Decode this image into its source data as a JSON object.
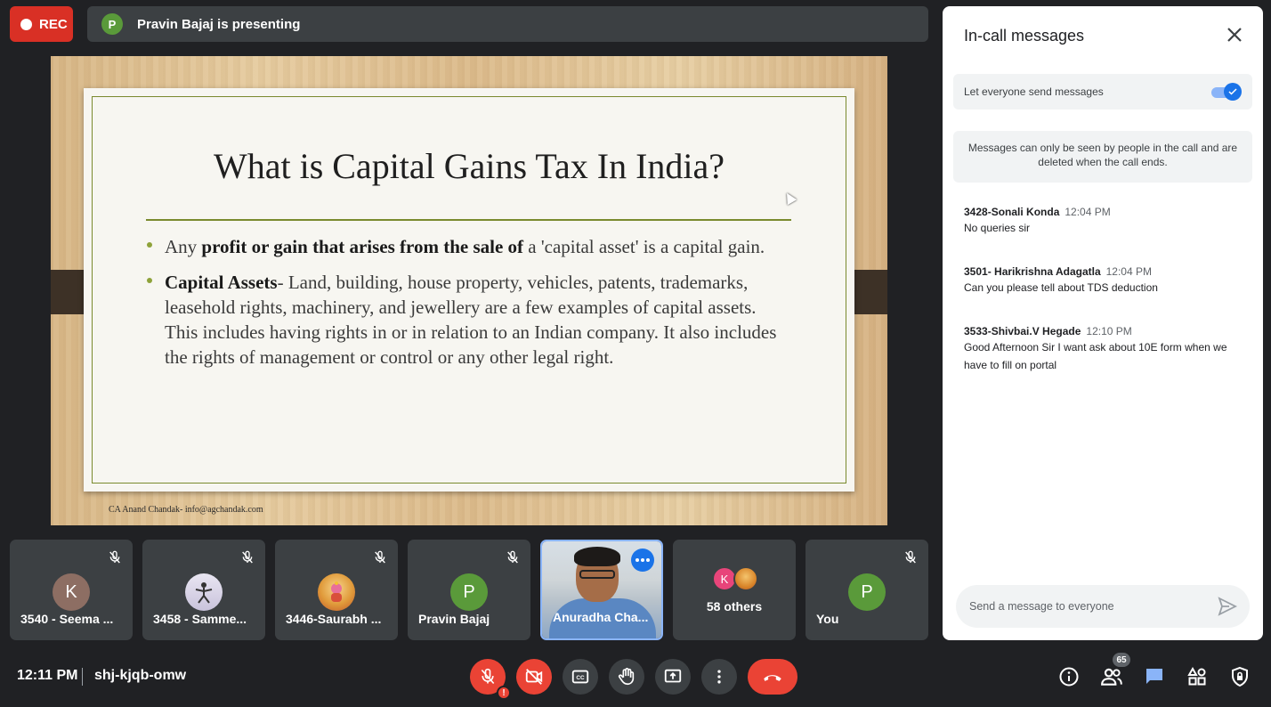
{
  "top": {
    "rec_label": "REC",
    "presenter_initial": "P",
    "presenting_text": "Pravin Bajaj is presenting"
  },
  "slide": {
    "title": "What is Capital Gains Tax In India?",
    "bullet1_pre": "Any ",
    "bullet1_bold": "profit or gain that arises from the sale of",
    "bullet1_post": " a 'capital asset' is a capital gain.",
    "bullet2_bold": "Capital Assets",
    "bullet2_post": "- Land, building, house property, vehicles, patents, trademarks, leasehold rights, machinery, and jewellery are a few examples of capital assets. This includes having rights in or in relation to an Indian company. It also includes the rights of management or control or any other legal right.",
    "footer": "CA Anand Chandak- info@agchandak.com"
  },
  "tiles": [
    {
      "name": "3540 - Seema ...",
      "initial": "K",
      "color": "#8d6e63"
    },
    {
      "name": "3458 - Samme...",
      "initial": "",
      "color": "#d7d3e8"
    },
    {
      "name": "3446-Saurabh ...",
      "initial": "",
      "color": "#f0c36a"
    },
    {
      "name": "Pravin Bajaj",
      "initial": "P",
      "color": "#5a9a3a"
    },
    {
      "name": "Anuradha Cha..."
    },
    {
      "name": "58 others",
      "initial": "K"
    },
    {
      "name": "You",
      "initial": "P",
      "color": "#5a9a3a"
    }
  ],
  "bottom": {
    "time": "12:11 PM",
    "meeting_code": "shj-kjqb-omw",
    "people_count": "65"
  },
  "chat": {
    "title": "In-call messages",
    "toggle_label": "Let everyone send messages",
    "toggle_on": true,
    "info": "Messages can only be seen by people in the call and are deleted when the call ends.",
    "messages": [
      {
        "sender": "3428-Sonali Konda",
        "time": "12:04 PM",
        "text": "No queries sir"
      },
      {
        "sender": "3501- Harikrishna Adagatla",
        "time": "12:04 PM",
        "text": "Can you please tell about TDS deduction"
      },
      {
        "sender": "3533-Shivbai.V Hegade",
        "time": "12:10 PM",
        "text": "Good Afternoon Sir I want ask about 10E form when we have to fill on portal"
      }
    ],
    "input_placeholder": "Send a message to everyone"
  }
}
